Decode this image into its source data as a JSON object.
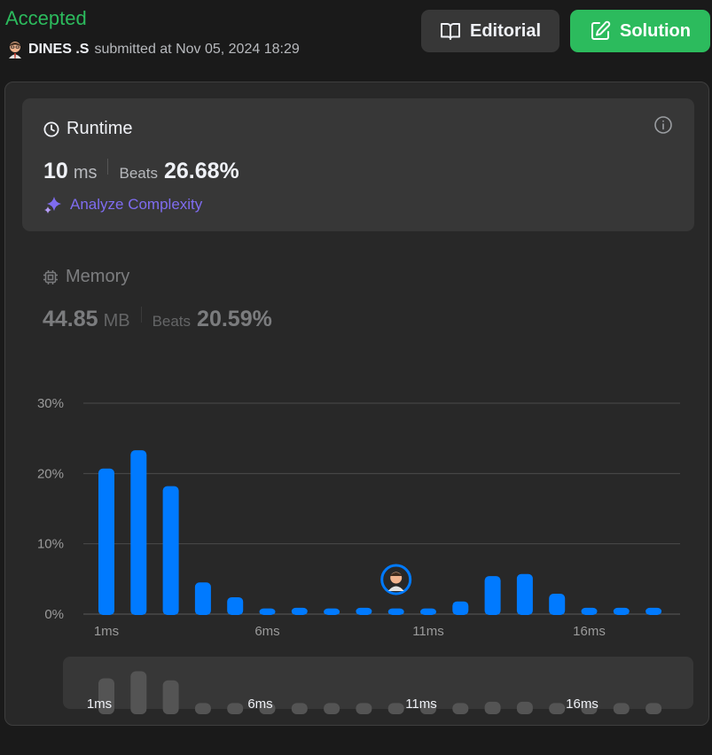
{
  "header": {
    "status": "Accepted",
    "user": "DINES .S",
    "submitted_text": "submitted at Nov 05, 2024 18:29",
    "editorial_label": "Editorial",
    "solution_label": "Solution"
  },
  "runtime": {
    "title": "Runtime",
    "value": "10",
    "unit": "ms",
    "beats_label": "Beats",
    "beats_value": "26.68%",
    "analyze_label": "Analyze Complexity"
  },
  "memory": {
    "title": "Memory",
    "value": "44.85",
    "unit": "MB",
    "beats_label": "Beats",
    "beats_value": "20.59%"
  },
  "colors": {
    "accepted": "#2cbb5d",
    "bar": "#007aff",
    "mini_bar": "#545454",
    "analyze": "#7f6cf0"
  },
  "icons": [
    "book-icon",
    "edit-icon",
    "clock-icon",
    "info-icon",
    "sparkle-icon",
    "chip-icon",
    "user-avatar-icon"
  ],
  "chart_data": {
    "type": "bar",
    "x": [
      1,
      2,
      3,
      4,
      5,
      6,
      7,
      8,
      9,
      10,
      11,
      12,
      13,
      14,
      15,
      16,
      17,
      18
    ],
    "categories": [
      "1ms",
      "",
      "",
      "",
      "",
      "6ms",
      "",
      "",
      "",
      "",
      "11ms",
      "",
      "",
      "",
      "",
      "16ms",
      "",
      ""
    ],
    "values": [
      20.7,
      23.3,
      18.2,
      4.5,
      2.4,
      0.8,
      0.9,
      0.8,
      0.9,
      0.8,
      0.8,
      1.8,
      5.4,
      5.7,
      2.9,
      0.9,
      0.9,
      0.9
    ],
    "user_marker_x": 10,
    "yticks": [
      "0%",
      "10%",
      "20%",
      "30%"
    ],
    "ylim": [
      0,
      30
    ],
    "grid": true,
    "mini_values": [
      4.7,
      5.8,
      4.4,
      0.9,
      0.9,
      0.9,
      0.9,
      0.9,
      0.9,
      0.9,
      0.9,
      0.9,
      1.1,
      1.1,
      0.9,
      0.9,
      0.9,
      0.9
    ],
    "mini_ticks": [
      "1ms",
      "6ms",
      "11ms",
      "16ms"
    ]
  }
}
